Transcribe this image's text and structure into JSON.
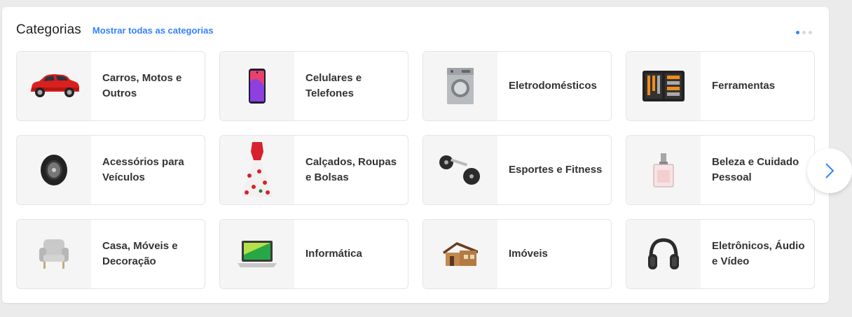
{
  "section": {
    "title": "Categorias",
    "show_all_label": "Mostrar todas as categorias",
    "accent_color": "#3483fa",
    "pager": {
      "pages": 3,
      "current": 1
    }
  },
  "categories": [
    {
      "label": "Carros, Motos e Outros",
      "icon": "car-icon"
    },
    {
      "label": "Celulares e Telefones",
      "icon": "smartphone-icon"
    },
    {
      "label": "Eletrodomésticos",
      "icon": "washing-machine-icon"
    },
    {
      "label": "Ferramentas",
      "icon": "toolbox-icon"
    },
    {
      "label": "Acessórios para Veículos",
      "icon": "tire-icon"
    },
    {
      "label": "Calçados, Roupas e Bolsas",
      "icon": "dress-icon"
    },
    {
      "label": "Esportes e Fitness",
      "icon": "dumbbell-icon"
    },
    {
      "label": "Beleza e Cuidado Pessoal",
      "icon": "perfume-icon"
    },
    {
      "label": "Casa, Móveis e Decoração",
      "icon": "armchair-icon"
    },
    {
      "label": "Informática",
      "icon": "laptop-icon"
    },
    {
      "label": "Imóveis",
      "icon": "house-icon"
    },
    {
      "label": "Eletrônicos, Áudio e Vídeo",
      "icon": "headphones-icon"
    }
  ],
  "carousel": {
    "next_icon": "chevron-right-icon"
  }
}
